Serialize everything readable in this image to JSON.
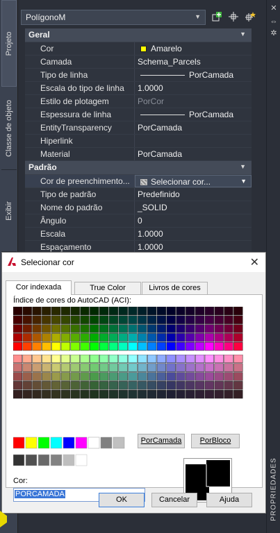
{
  "side_tabs": [
    "Projeto",
    "Classe de objeto",
    "Exibir"
  ],
  "right_panel_title": "PROPRIEDADES",
  "object_selector": {
    "value": "PolígonoM"
  },
  "categories": {
    "geral": "Geral",
    "padrao": "Padrão"
  },
  "geral_rows": [
    {
      "label": "Cor",
      "value": "Amarelo"
    },
    {
      "label": "Camada",
      "value": "Schema_Parcels"
    },
    {
      "label": "Tipo de linha",
      "value": "PorCamada"
    },
    {
      "label": "Escala do tipo de linha",
      "value": "1.0000"
    },
    {
      "label": "Estilo de plotagem",
      "value": "PorCor"
    },
    {
      "label": "Espessura de linha",
      "value": "PorCamada"
    },
    {
      "label": "EntityTransparency",
      "value": "PorCamada"
    },
    {
      "label": "Hiperlink",
      "value": ""
    },
    {
      "label": "Material",
      "value": "PorCamada"
    }
  ],
  "padrao_rows": [
    {
      "label": "Cor de preenchimento...",
      "value": "Selecionar cor..."
    },
    {
      "label": "Tipo de padrão",
      "value": "Predefinido"
    },
    {
      "label": "Nome do padrão",
      "value": "_SOLID"
    },
    {
      "label": "Ângulo",
      "value": "0"
    },
    {
      "label": "Escala",
      "value": "1.0000"
    },
    {
      "label": "Espaçamento",
      "value": "1.0000"
    }
  ],
  "dialog": {
    "title": "Selecionar cor",
    "tabs": [
      "Cor indexada",
      "True Color",
      "Livros de cores"
    ],
    "aci_label": "Índice de cores do AutoCAD (ACI):",
    "bylayer_button": "PorCamada",
    "byblock_button": "PorBloco",
    "color_label": "Cor:",
    "color_value": "PORCAMADA",
    "ok": "OK",
    "cancel": "Cancelar",
    "help": "Ajuda"
  },
  "colors": {
    "std": [
      "#ff0000",
      "#ffff00",
      "#00ff00",
      "#00ffff",
      "#0000ff",
      "#ff00ff",
      "#ffffff",
      "#808080",
      "#c0c0c0"
    ],
    "grays": [
      "#333333",
      "#505050",
      "#696969",
      "#828282",
      "#bebebe",
      "#ffffff"
    ]
  }
}
